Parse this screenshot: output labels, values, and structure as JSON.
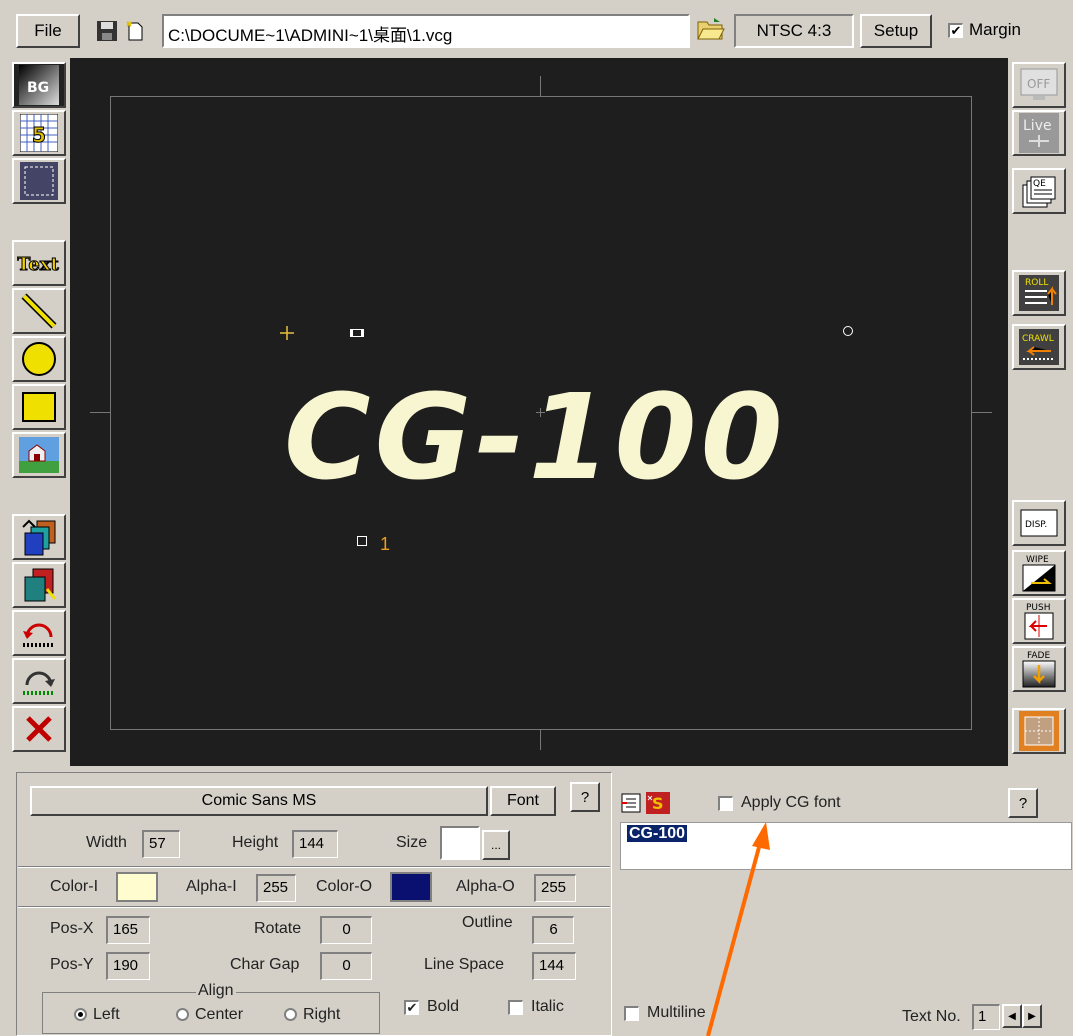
{
  "toolbar": {
    "file_label": "File",
    "path": "C:\\DOCUME~1\\ADMINI~1\\桌面\\1.vcg",
    "video_mode": "NTSC 4:3",
    "setup_label": "Setup",
    "margin_label": "Margin",
    "margin_checked": true
  },
  "left_tools": {
    "bg_label": "BG",
    "grid_label": "5",
    "text_label": "Text"
  },
  "right_tools": {
    "off_label": "OFF",
    "live_label": "Live",
    "qe_label": "QE",
    "roll_label": "ROLL",
    "crawl_label": "CRAWL",
    "disp_label": "DISP.",
    "wipe_label": "WIPE",
    "push_label": "PUSH",
    "fade_label": "FADE"
  },
  "canvas": {
    "text": "CG-100",
    "object_number": "1"
  },
  "font_panel": {
    "font_name": "Comic Sans MS",
    "font_button": "Font",
    "help": "?",
    "width_label": "Width",
    "width_value": "57",
    "height_label": "Height",
    "height_value": "144",
    "size_label": "Size",
    "size_browse": "...",
    "color_i_label": "Color-I",
    "alpha_i_label": "Alpha-I",
    "alpha_i_value": "255",
    "color_o_label": "Color-O",
    "alpha_o_label": "Alpha-O",
    "alpha_o_value": "255",
    "pos_x_label": "Pos-X",
    "pos_x_value": "165",
    "pos_y_label": "Pos-Y",
    "pos_y_value": "190",
    "rotate_label": "Rotate",
    "rotate_value": "0",
    "char_gap_label": "Char Gap",
    "char_gap_value": "0",
    "outline_label": "Outline",
    "outline_value": "6",
    "line_space_label": "Line Space",
    "line_space_value": "144",
    "align_label": "Align",
    "align_left": "Left",
    "align_center": "Center",
    "align_right": "Right",
    "bold_label": "Bold",
    "italic_label": "Italic"
  },
  "text_panel": {
    "apply_cg_font_label": "Apply CG font",
    "help": "?",
    "content": "CG-100",
    "multiline_label": "Multiline",
    "text_no_label": "Text No.",
    "text_no_value": "1"
  },
  "colors": {
    "canvas_bg": "#1e1e1e",
    "text_fill": "#f8f6d0",
    "color_i": "#fffcd0",
    "color_o": "#0a1070",
    "arrow": "#ff6a00",
    "selection": "#0a246a"
  }
}
